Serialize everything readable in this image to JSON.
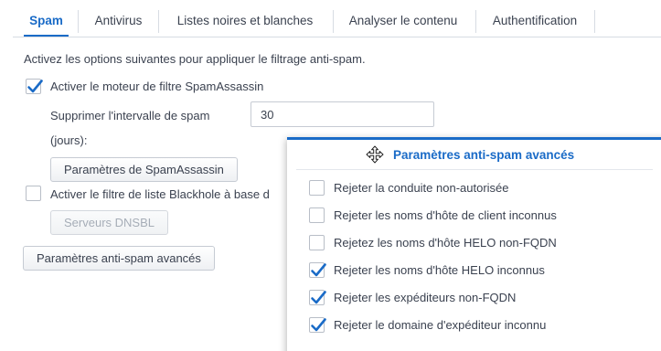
{
  "tabs": [
    {
      "label": "Spam"
    },
    {
      "label": "Antivirus"
    },
    {
      "label": "Listes noires et blanches"
    },
    {
      "label": "Analyser le contenu"
    },
    {
      "label": "Authentification"
    }
  ],
  "spam": {
    "intro": "Activez les options suivantes pour appliquer le filtrage anti-spam.",
    "enable_spamassassin_label": "Activer le moteur de filtre SpamAssassin",
    "enable_spamassassin_checked": true,
    "delete_interval_label_line1": "Supprimer l'intervalle de spam",
    "delete_interval_label_line2": "(jours):",
    "delete_interval_value": "30",
    "spamassassin_settings_button": "Paramètres de SpamAssassin",
    "enable_blackhole_label": "Activer le filtre de liste Blackhole à base d",
    "enable_blackhole_checked": false,
    "dnsbl_servers_button": "Serveurs DNSBL",
    "advanced_button": "Paramètres anti-spam avancés"
  },
  "panel": {
    "title": "Paramètres anti-spam avancés",
    "move_icon": "move-cursor-icon",
    "options": [
      {
        "label": "Rejeter la conduite non-autorisée",
        "checked": false
      },
      {
        "label": "Rejeter les noms d'hôte de client inconnus",
        "checked": false
      },
      {
        "label": "Rejetez les noms d'hôte HELO non-FQDN",
        "checked": false
      },
      {
        "label": "Rejeter les noms d'hôte HELO inconnus",
        "checked": true
      },
      {
        "label": "Rejeter les expéditeurs non-FQDN",
        "checked": true
      },
      {
        "label": "Rejeter le domaine d'expéditeur inconnu",
        "checked": true
      }
    ]
  },
  "colors": {
    "accent": "#1a6bc7",
    "text": "#3b4250",
    "border": "#c6cbd3"
  }
}
